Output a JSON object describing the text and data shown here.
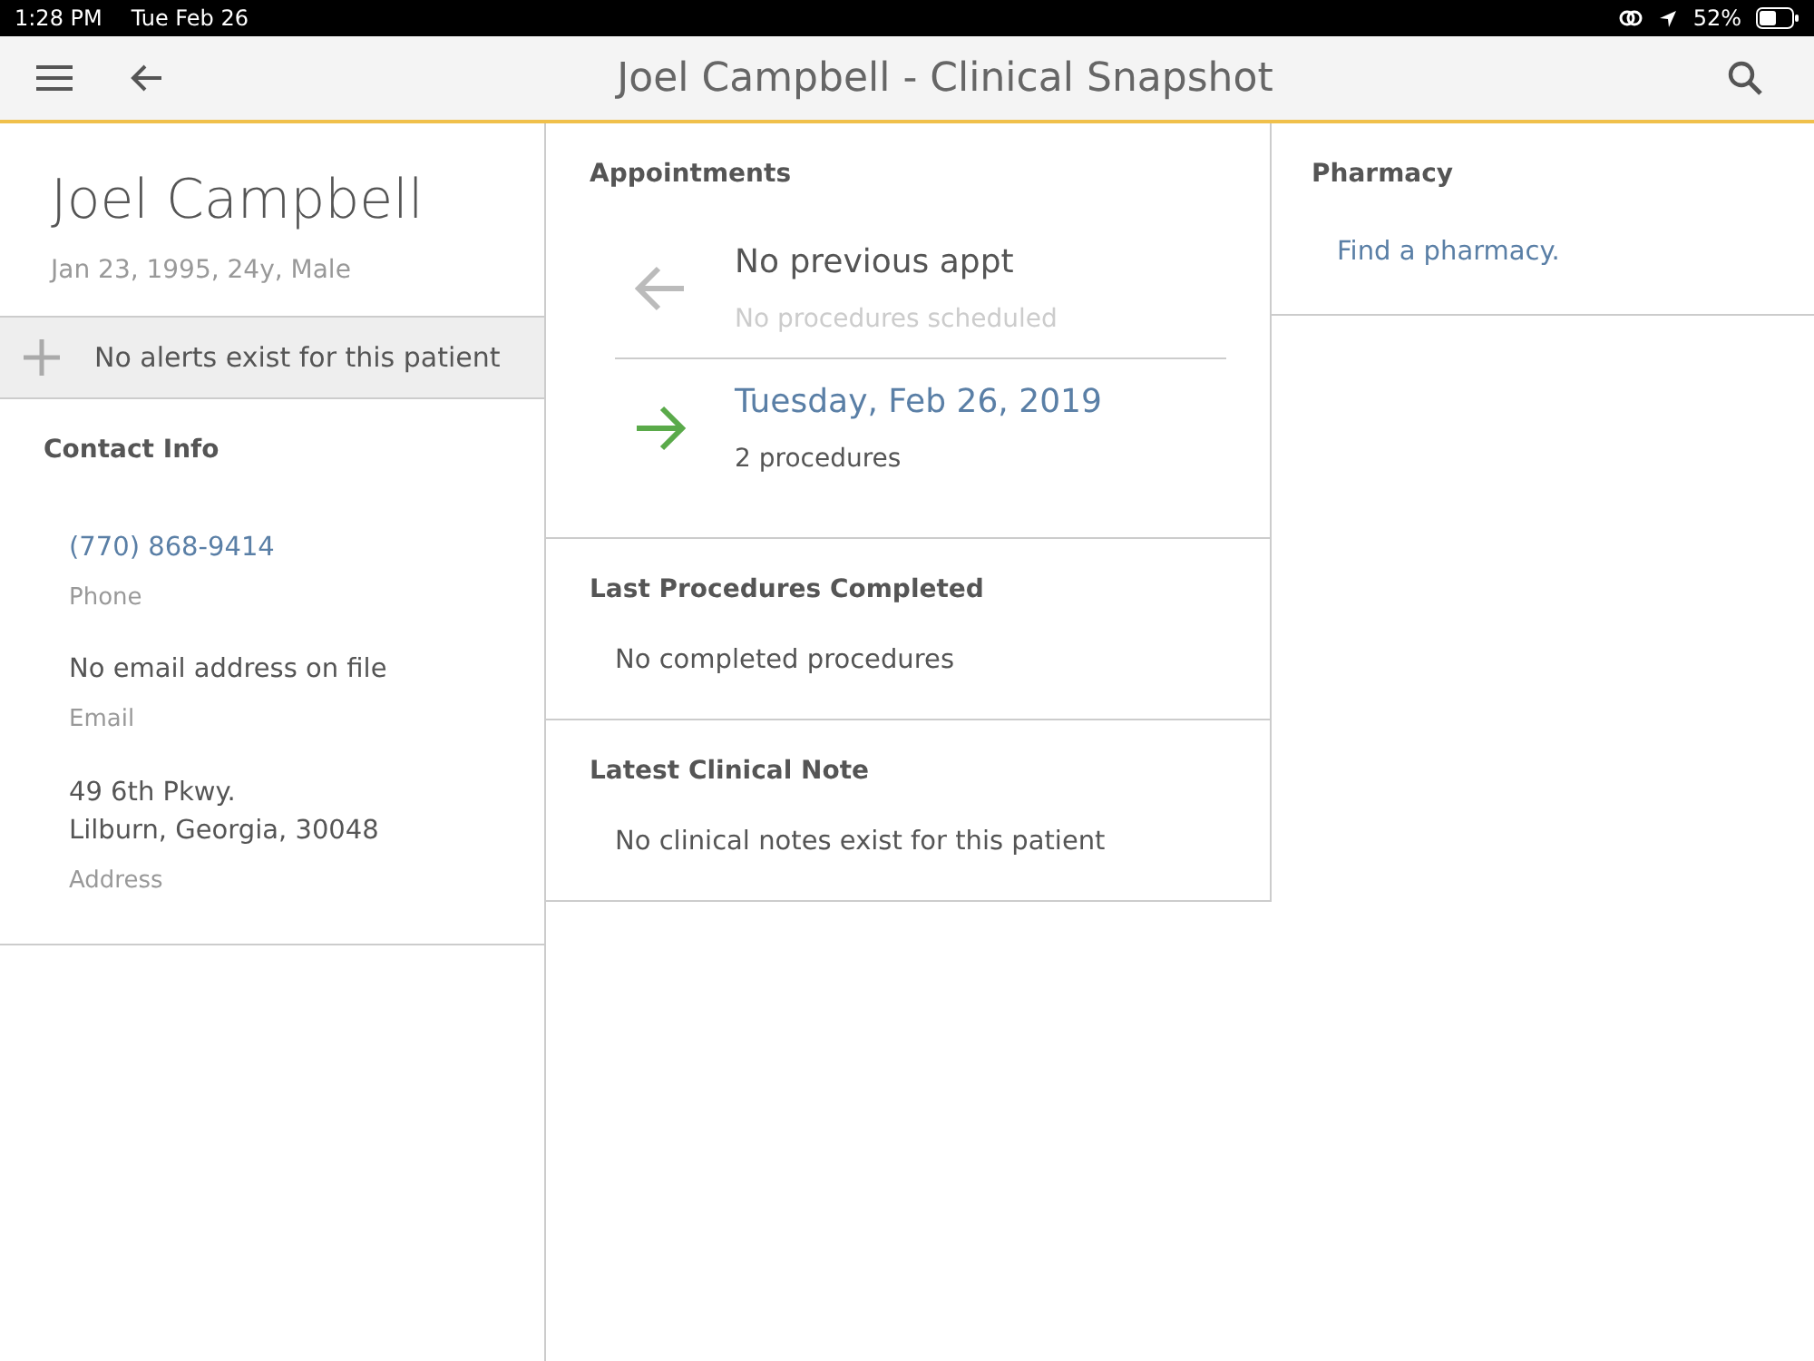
{
  "status_bar": {
    "time": "1:28 PM",
    "date": "Tue Feb 26",
    "battery_text": "52%"
  },
  "header": {
    "title": "Joel Campbell - Clinical Snapshot"
  },
  "patient": {
    "name": "Joel Campbell",
    "details": "Jan 23, 1995, 24y, Male",
    "alert": "No alerts exist for this patient"
  },
  "contact": {
    "title": "Contact Info",
    "items": [
      {
        "kind": "link",
        "value": "(770) 868-9414",
        "label": "Phone"
      },
      {
        "kind": "text",
        "value": "No email address on file",
        "label": "Email"
      },
      {
        "kind": "text",
        "value": "49 6th Pkwy.\nLilburn, Georgia, 30048",
        "label": "Address"
      }
    ]
  },
  "appointments": {
    "title": "Appointments",
    "items": [
      {
        "kind": "previous",
        "title": "No previous appt",
        "subtitle": "No procedures scheduled"
      },
      {
        "kind": "next",
        "title": "Tuesday, Feb 26, 2019",
        "subtitle": "2 procedures"
      }
    ]
  },
  "sections": [
    {
      "title": "Last Procedures Completed",
      "text": "No completed procedures"
    },
    {
      "title": "Latest Clinical Note",
      "text": "No clinical notes exist for this patient"
    }
  ],
  "pharmacy": {
    "title": "Pharmacy",
    "link": "Find a pharmacy."
  }
}
